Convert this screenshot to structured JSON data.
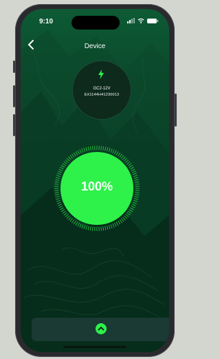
{
  "status_bar": {
    "time": "9:10",
    "icons": [
      "signal-icon",
      "wifi-icon",
      "battery-icon"
    ]
  },
  "header": {
    "back_icon": "chevron-left-icon",
    "title": "Device"
  },
  "device": {
    "icon": "lightning-bolt-icon",
    "model": "GC2-12V",
    "serial": "EX1144H41230013"
  },
  "battery": {
    "percent_label": "100%",
    "level": 1.0
  },
  "bottom_panel": {
    "expand_icon": "chevron-up-icon"
  },
  "colors": {
    "accent": "#2ef24a",
    "background_top": "#0d5b35",
    "background_bottom": "#041a10",
    "panel": "#1a3a33"
  }
}
